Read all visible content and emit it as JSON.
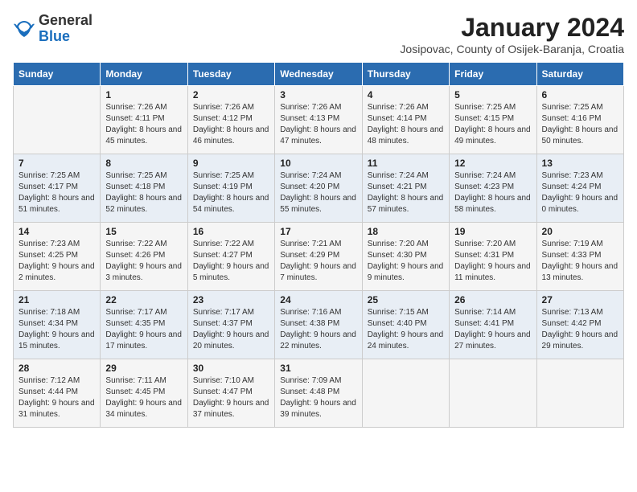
{
  "logo": {
    "text_general": "General",
    "text_blue": "Blue"
  },
  "title": "January 2024",
  "location": "Josipovac, County of Osijek-Baranja, Croatia",
  "days_of_week": [
    "Sunday",
    "Monday",
    "Tuesday",
    "Wednesday",
    "Thursday",
    "Friday",
    "Saturday"
  ],
  "weeks": [
    [
      {
        "num": "",
        "sunrise": "",
        "sunset": "",
        "daylight": ""
      },
      {
        "num": "1",
        "sunrise": "Sunrise: 7:26 AM",
        "sunset": "Sunset: 4:11 PM",
        "daylight": "Daylight: 8 hours and 45 minutes."
      },
      {
        "num": "2",
        "sunrise": "Sunrise: 7:26 AM",
        "sunset": "Sunset: 4:12 PM",
        "daylight": "Daylight: 8 hours and 46 minutes."
      },
      {
        "num": "3",
        "sunrise": "Sunrise: 7:26 AM",
        "sunset": "Sunset: 4:13 PM",
        "daylight": "Daylight: 8 hours and 47 minutes."
      },
      {
        "num": "4",
        "sunrise": "Sunrise: 7:26 AM",
        "sunset": "Sunset: 4:14 PM",
        "daylight": "Daylight: 8 hours and 48 minutes."
      },
      {
        "num": "5",
        "sunrise": "Sunrise: 7:25 AM",
        "sunset": "Sunset: 4:15 PM",
        "daylight": "Daylight: 8 hours and 49 minutes."
      },
      {
        "num": "6",
        "sunrise": "Sunrise: 7:25 AM",
        "sunset": "Sunset: 4:16 PM",
        "daylight": "Daylight: 8 hours and 50 minutes."
      }
    ],
    [
      {
        "num": "7",
        "sunrise": "Sunrise: 7:25 AM",
        "sunset": "Sunset: 4:17 PM",
        "daylight": "Daylight: 8 hours and 51 minutes."
      },
      {
        "num": "8",
        "sunrise": "Sunrise: 7:25 AM",
        "sunset": "Sunset: 4:18 PM",
        "daylight": "Daylight: 8 hours and 52 minutes."
      },
      {
        "num": "9",
        "sunrise": "Sunrise: 7:25 AM",
        "sunset": "Sunset: 4:19 PM",
        "daylight": "Daylight: 8 hours and 54 minutes."
      },
      {
        "num": "10",
        "sunrise": "Sunrise: 7:24 AM",
        "sunset": "Sunset: 4:20 PM",
        "daylight": "Daylight: 8 hours and 55 minutes."
      },
      {
        "num": "11",
        "sunrise": "Sunrise: 7:24 AM",
        "sunset": "Sunset: 4:21 PM",
        "daylight": "Daylight: 8 hours and 57 minutes."
      },
      {
        "num": "12",
        "sunrise": "Sunrise: 7:24 AM",
        "sunset": "Sunset: 4:23 PM",
        "daylight": "Daylight: 8 hours and 58 minutes."
      },
      {
        "num": "13",
        "sunrise": "Sunrise: 7:23 AM",
        "sunset": "Sunset: 4:24 PM",
        "daylight": "Daylight: 9 hours and 0 minutes."
      }
    ],
    [
      {
        "num": "14",
        "sunrise": "Sunrise: 7:23 AM",
        "sunset": "Sunset: 4:25 PM",
        "daylight": "Daylight: 9 hours and 2 minutes."
      },
      {
        "num": "15",
        "sunrise": "Sunrise: 7:22 AM",
        "sunset": "Sunset: 4:26 PM",
        "daylight": "Daylight: 9 hours and 3 minutes."
      },
      {
        "num": "16",
        "sunrise": "Sunrise: 7:22 AM",
        "sunset": "Sunset: 4:27 PM",
        "daylight": "Daylight: 9 hours and 5 minutes."
      },
      {
        "num": "17",
        "sunrise": "Sunrise: 7:21 AM",
        "sunset": "Sunset: 4:29 PM",
        "daylight": "Daylight: 9 hours and 7 minutes."
      },
      {
        "num": "18",
        "sunrise": "Sunrise: 7:20 AM",
        "sunset": "Sunset: 4:30 PM",
        "daylight": "Daylight: 9 hours and 9 minutes."
      },
      {
        "num": "19",
        "sunrise": "Sunrise: 7:20 AM",
        "sunset": "Sunset: 4:31 PM",
        "daylight": "Daylight: 9 hours and 11 minutes."
      },
      {
        "num": "20",
        "sunrise": "Sunrise: 7:19 AM",
        "sunset": "Sunset: 4:33 PM",
        "daylight": "Daylight: 9 hours and 13 minutes."
      }
    ],
    [
      {
        "num": "21",
        "sunrise": "Sunrise: 7:18 AM",
        "sunset": "Sunset: 4:34 PM",
        "daylight": "Daylight: 9 hours and 15 minutes."
      },
      {
        "num": "22",
        "sunrise": "Sunrise: 7:17 AM",
        "sunset": "Sunset: 4:35 PM",
        "daylight": "Daylight: 9 hours and 17 minutes."
      },
      {
        "num": "23",
        "sunrise": "Sunrise: 7:17 AM",
        "sunset": "Sunset: 4:37 PM",
        "daylight": "Daylight: 9 hours and 20 minutes."
      },
      {
        "num": "24",
        "sunrise": "Sunrise: 7:16 AM",
        "sunset": "Sunset: 4:38 PM",
        "daylight": "Daylight: 9 hours and 22 minutes."
      },
      {
        "num": "25",
        "sunrise": "Sunrise: 7:15 AM",
        "sunset": "Sunset: 4:40 PM",
        "daylight": "Daylight: 9 hours and 24 minutes."
      },
      {
        "num": "26",
        "sunrise": "Sunrise: 7:14 AM",
        "sunset": "Sunset: 4:41 PM",
        "daylight": "Daylight: 9 hours and 27 minutes."
      },
      {
        "num": "27",
        "sunrise": "Sunrise: 7:13 AM",
        "sunset": "Sunset: 4:42 PM",
        "daylight": "Daylight: 9 hours and 29 minutes."
      }
    ],
    [
      {
        "num": "28",
        "sunrise": "Sunrise: 7:12 AM",
        "sunset": "Sunset: 4:44 PM",
        "daylight": "Daylight: 9 hours and 31 minutes."
      },
      {
        "num": "29",
        "sunrise": "Sunrise: 7:11 AM",
        "sunset": "Sunset: 4:45 PM",
        "daylight": "Daylight: 9 hours and 34 minutes."
      },
      {
        "num": "30",
        "sunrise": "Sunrise: 7:10 AM",
        "sunset": "Sunset: 4:47 PM",
        "daylight": "Daylight: 9 hours and 37 minutes."
      },
      {
        "num": "31",
        "sunrise": "Sunrise: 7:09 AM",
        "sunset": "Sunset: 4:48 PM",
        "daylight": "Daylight: 9 hours and 39 minutes."
      },
      {
        "num": "",
        "sunrise": "",
        "sunset": "",
        "daylight": ""
      },
      {
        "num": "",
        "sunrise": "",
        "sunset": "",
        "daylight": ""
      },
      {
        "num": "",
        "sunrise": "",
        "sunset": "",
        "daylight": ""
      }
    ]
  ]
}
